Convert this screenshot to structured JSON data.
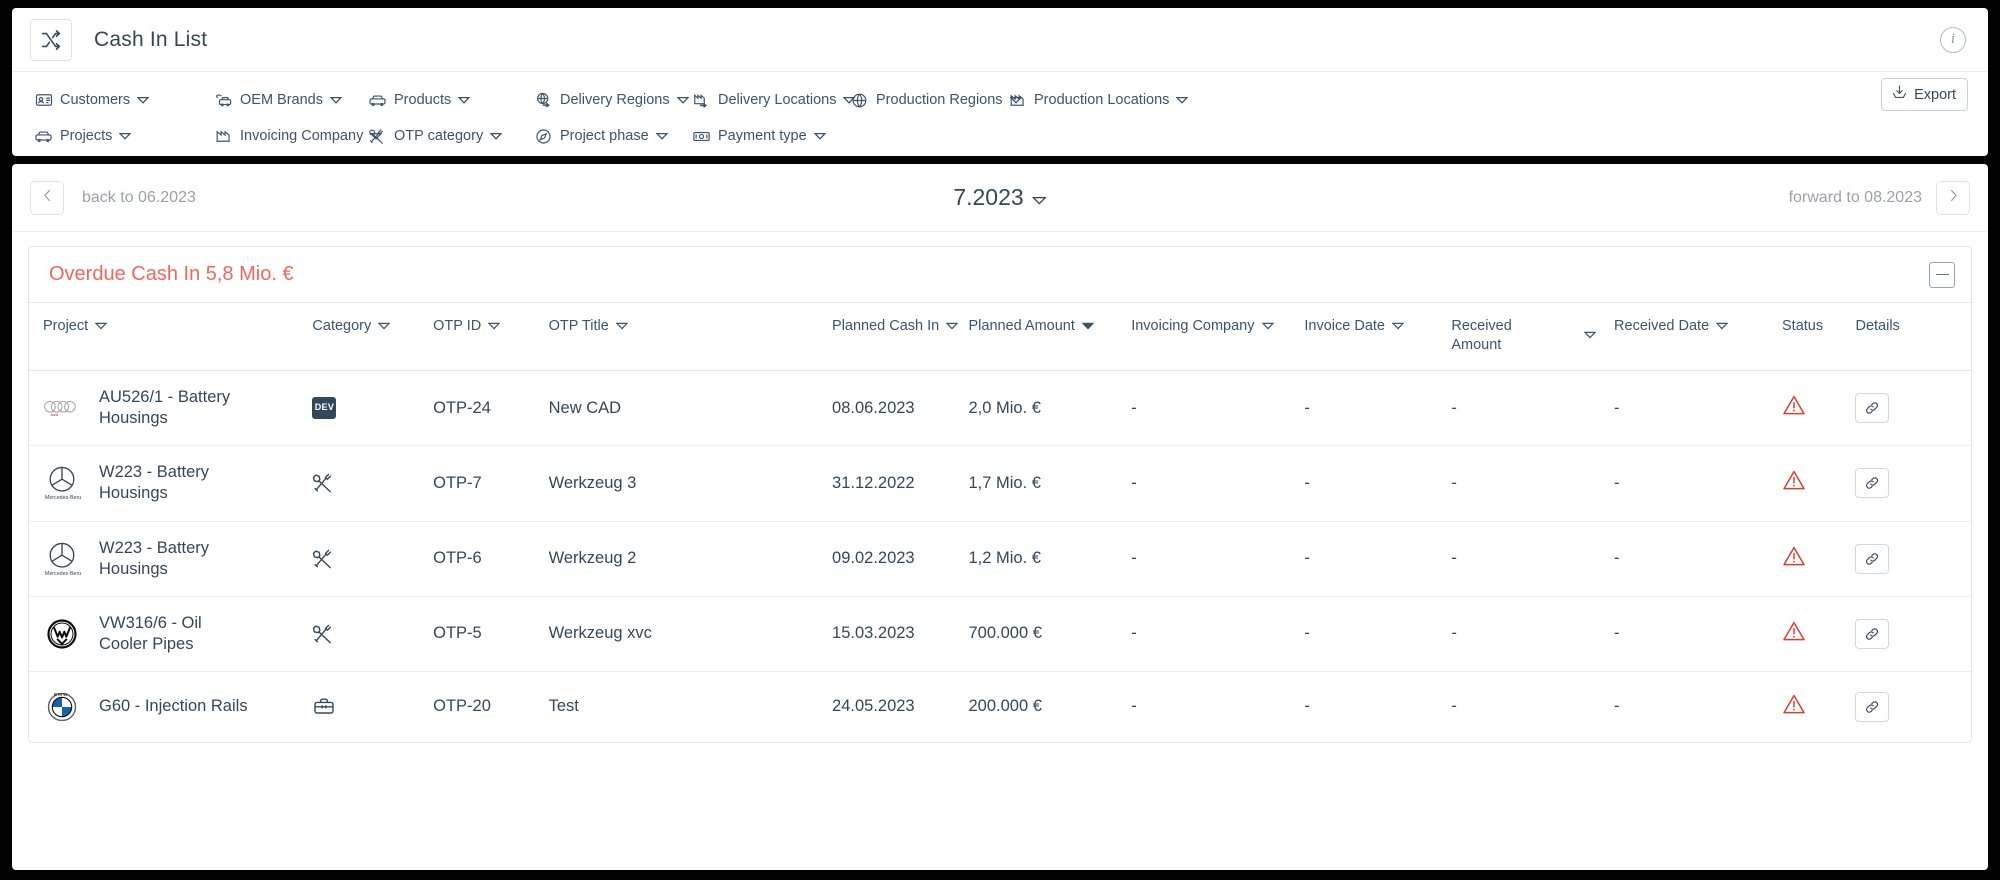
{
  "header": {
    "app_icon": "shuffle-icon",
    "title": "Cash In List",
    "info_icon": "info-icon"
  },
  "filters": {
    "export_label": "Export",
    "export_icon": "download-icon",
    "row1": [
      {
        "label": "Customers",
        "icon": "contact-card-icon"
      },
      {
        "label": "OEM Brands",
        "icon": "car-brand-icon"
      },
      {
        "label": "Products",
        "icon": "car-icon"
      },
      {
        "label": "Delivery Regions",
        "icon": "globe-arrow-icon"
      },
      {
        "label": "Delivery Locations",
        "icon": "factory-arrow-icon"
      },
      {
        "label": "Production Regions",
        "icon": "globe-icon"
      },
      {
        "label": "Production Locations",
        "icon": "factory-icon"
      }
    ],
    "row2": [
      {
        "label": "Projects",
        "icon": "car-icon"
      },
      {
        "label": "Invoicing Company",
        "icon": "factory-icon"
      },
      {
        "label": "OTP category",
        "icon": "tools-icon"
      },
      {
        "label": "Project phase",
        "icon": "compass-icon"
      },
      {
        "label": "Payment type",
        "icon": "banknote-icon"
      }
    ]
  },
  "nav": {
    "back_label": "back to 06.2023",
    "back_icon": "chevron-left-icon",
    "current_period": "7.2023",
    "forward_label": "forward to 08.2023",
    "forward_icon": "chevron-right-icon"
  },
  "section": {
    "title": "Overdue Cash In 5,8 Mio. €",
    "title_color": "#f2675c",
    "collapse_icon": "minus-square-icon"
  },
  "table": {
    "columns": [
      {
        "label": "Project",
        "sortable": true,
        "sort": "none"
      },
      {
        "label": "Category",
        "sortable": true,
        "sort": "none"
      },
      {
        "label": "OTP ID",
        "sortable": true,
        "sort": "none"
      },
      {
        "label": "OTP Title",
        "sortable": true,
        "sort": "none"
      },
      {
        "label": "Planned Cash In",
        "sortable": true,
        "sort": "none"
      },
      {
        "label": "Planned Amount",
        "sortable": true,
        "sort": "desc"
      },
      {
        "label": "Invoicing Company",
        "sortable": true,
        "sort": "none"
      },
      {
        "label": "Invoice Date",
        "sortable": true,
        "sort": "none"
      },
      {
        "label": "Received Amount",
        "sortable": true,
        "sort": "none"
      },
      {
        "label": "Received Date",
        "sortable": true,
        "sort": "none"
      },
      {
        "label": "Status",
        "sortable": false,
        "sort": "none"
      },
      {
        "label": "Details",
        "sortable": false,
        "sort": "none"
      }
    ],
    "rows": [
      {
        "brand": "audi",
        "project": "AU526/1 - Battery Housings",
        "category_icon": "dev-badge",
        "category_label": "DEV",
        "otp_id": "OTP-24",
        "otp_title": "New CAD",
        "planned_cash_in": "08.06.2023",
        "planned_amount": "2,0 Mio. €",
        "invoicing_company": "-",
        "invoice_date": "-",
        "received_amount": "-",
        "received_date": "-",
        "status": "warning",
        "details_icon": "link-icon"
      },
      {
        "brand": "mercedes",
        "project": "W223 - Battery Housings",
        "category_icon": "tools-icon",
        "category_label": "",
        "otp_id": "OTP-7",
        "otp_title": "Werkzeug 3",
        "planned_cash_in": "31.12.2022",
        "planned_amount": "1,7 Mio. €",
        "invoicing_company": "-",
        "invoice_date": "-",
        "received_amount": "-",
        "received_date": "-",
        "status": "warning",
        "details_icon": "link-icon"
      },
      {
        "brand": "mercedes",
        "project": "W223 - Battery Housings",
        "category_icon": "tools-icon",
        "category_label": "",
        "otp_id": "OTP-6",
        "otp_title": "Werkzeug 2",
        "planned_cash_in": "09.02.2023",
        "planned_amount": "1,2 Mio. €",
        "invoicing_company": "-",
        "invoice_date": "-",
        "received_amount": "-",
        "received_date": "-",
        "status": "warning",
        "details_icon": "link-icon"
      },
      {
        "brand": "vw",
        "project": "VW316/6 - Oil Cooler Pipes",
        "category_icon": "tools-icon",
        "category_label": "",
        "otp_id": "OTP-5",
        "otp_title": "Werkzeug xvc",
        "planned_cash_in": "15.03.2023",
        "planned_amount": "700.000 €",
        "invoicing_company": "-",
        "invoice_date": "-",
        "received_amount": "-",
        "received_date": "-",
        "status": "warning",
        "details_icon": "link-icon"
      },
      {
        "brand": "bmw",
        "project": "G60 - Injection Rails",
        "category_icon": "toolbox-icon",
        "category_label": "",
        "otp_id": "OTP-20",
        "otp_title": "Test",
        "planned_cash_in": "24.05.2023",
        "planned_amount": "200.000 €",
        "invoicing_company": "-",
        "invoice_date": "-",
        "received_amount": "-",
        "received_date": "-",
        "status": "warning",
        "details_icon": "link-icon"
      }
    ]
  },
  "colors": {
    "text": "#33475b",
    "muted": "#9aa1a8",
    "accent_red": "#f2675c",
    "warning": "#e03b2f",
    "border": "#e4e7ea"
  }
}
